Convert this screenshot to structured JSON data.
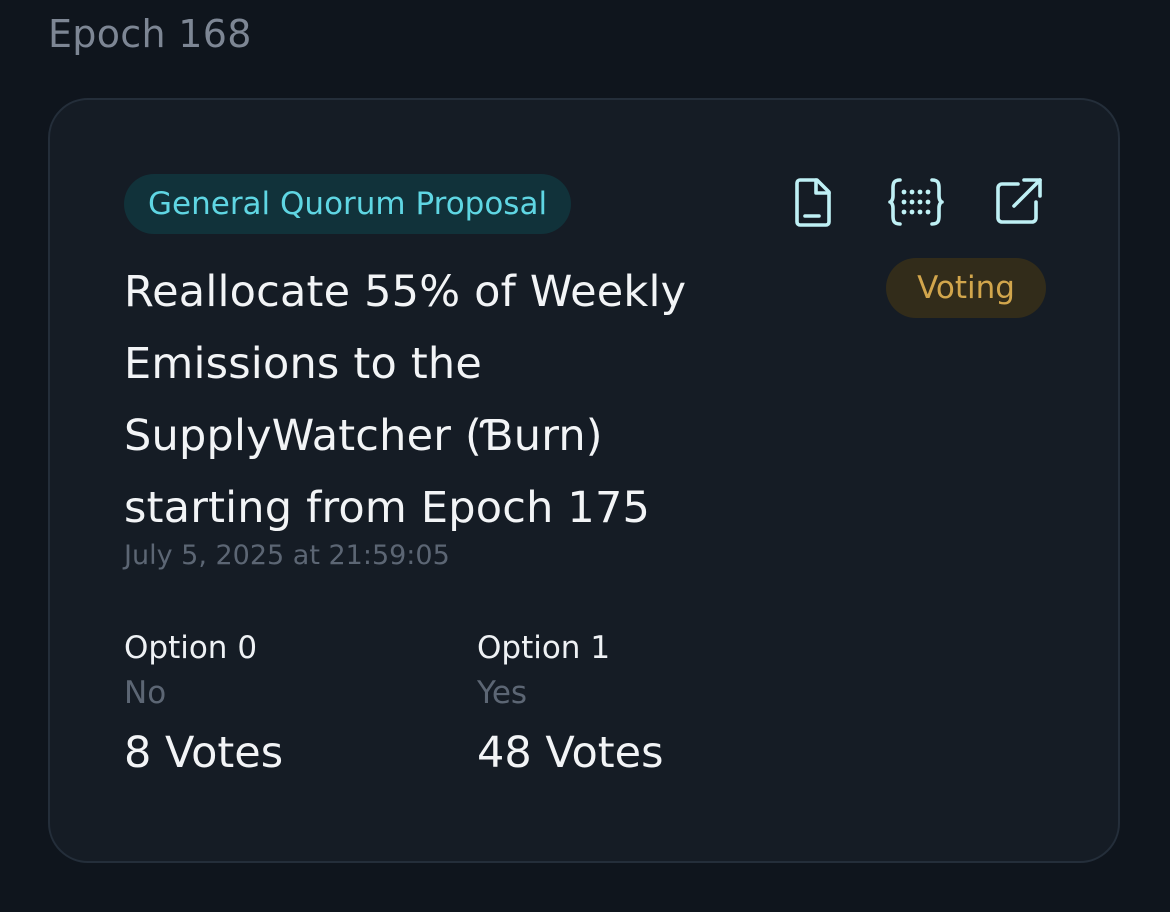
{
  "epoch": {
    "heading": "Epoch 168"
  },
  "proposal": {
    "type_label": "General Quorum Proposal",
    "status": "Voting",
    "title": "Reallocate 55% of Weekly Emissions to the SupplyWatcher (Ɓurn) starting from Epoch 175",
    "timestamp": "July 5, 2025 at 21:59:05",
    "actions": [
      {
        "icon": "document-icon"
      },
      {
        "icon": "code-icon"
      },
      {
        "icon": "external-link-icon"
      }
    ],
    "options": [
      {
        "label": "Option 0",
        "name": "No",
        "votes": "8 Votes"
      },
      {
        "label": "Option 1",
        "name": "Yes",
        "votes": "48 Votes"
      }
    ]
  },
  "colors": {
    "background": "#0f151d",
    "card": "#151c25",
    "accent_cyan": "#5fd6e3",
    "status_voting": "#d2a64c"
  }
}
